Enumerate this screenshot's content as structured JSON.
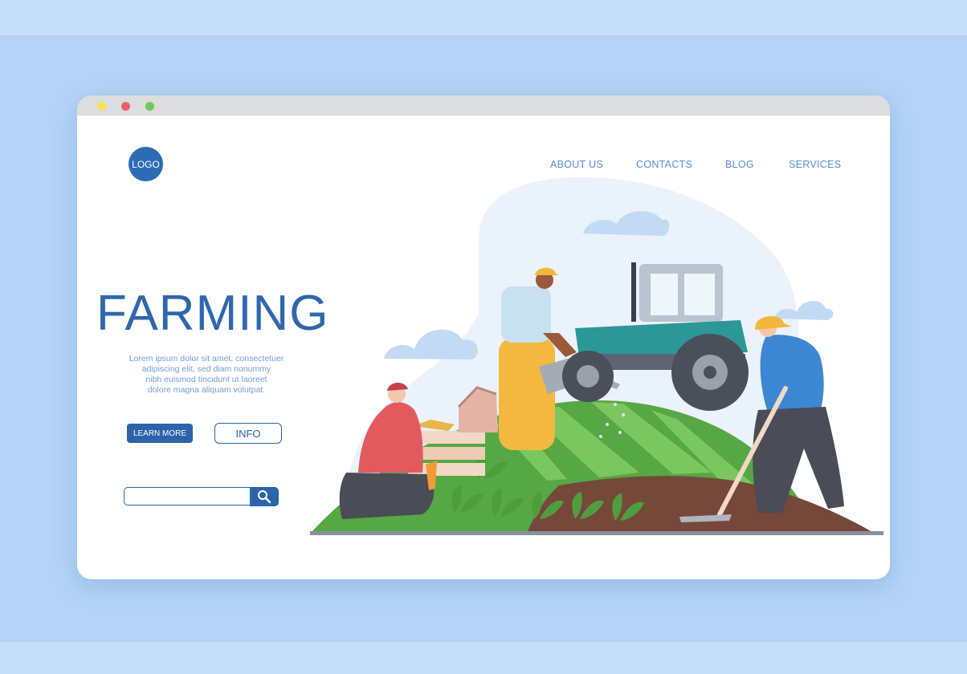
{
  "window": {
    "controls": [
      "yellow",
      "red",
      "green"
    ]
  },
  "header": {
    "logo_label": "LOGO",
    "nav": {
      "about": "ABOUT US",
      "contacts": "CONTACTS",
      "blog": "BLOG",
      "services": "SERVICES"
    }
  },
  "hero": {
    "title": "FARMING",
    "text_line1": "Lorem ipsum dolor sit amet, consectetuer",
    "text_line2": "adipiscing elit, sed diam nonummy",
    "text_line3": "nibh euismod tincidunt ut laoreet",
    "text_line4": "dolore magna aliquam volutpat.",
    "learn_more_label": "LEARN MORE",
    "info_label": "INFO"
  },
  "search": {
    "value": "",
    "icon": "search-icon"
  },
  "colors": {
    "background": "#b4d3f6",
    "primary": "#2c63aa",
    "nav": "#5a8fcf",
    "field_green": "#5fb24c",
    "soil": "#7a4a3a"
  }
}
